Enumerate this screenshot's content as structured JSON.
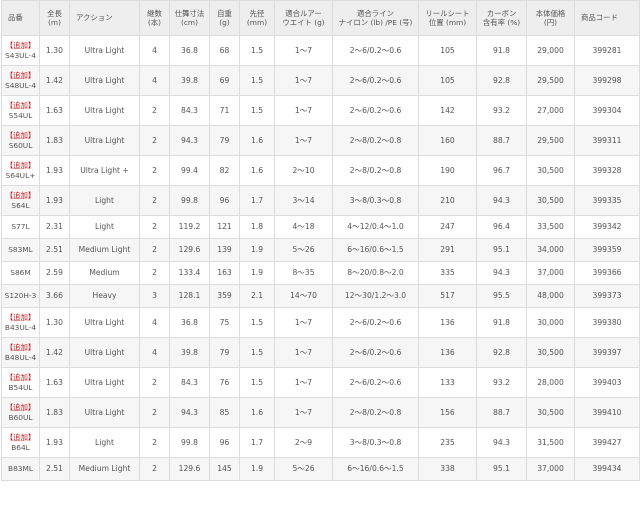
{
  "headers": [
    "品番",
    "全長\n(m)",
    "アクション",
    "継数\n(本)",
    "仕舞寸法\n(cm)",
    "自重\n(g)",
    "先径\n(mm)",
    "適合ルアー\nウエイト (g)",
    "適合ライン\nナイロン (lb) /PE (号)",
    "リールシート\n位置 (mm)",
    "カーボン\n含有率 (%)",
    "本体価格\n(円)",
    "商品コード"
  ],
  "rows": [
    {
      "tag": "【追加】",
      "cells": [
        "S43UL-4",
        "1.30",
        "Ultra Light",
        "4",
        "36.8",
        "68",
        "1.5",
        "1〜7",
        "2〜6/0.2〜0.6",
        "105",
        "91.8",
        "29,000",
        "399281"
      ]
    },
    {
      "tag": "【追加】",
      "cells": [
        "S48UL-4",
        "1.42",
        "Ultra Light",
        "4",
        "39.8",
        "69",
        "1.5",
        "1〜7",
        "2〜6/0.2〜0.6",
        "105",
        "92.8",
        "29,500",
        "399298"
      ]
    },
    {
      "tag": "【追加】",
      "cells": [
        "S54UL",
        "1.63",
        "Ultra Light",
        "2",
        "84.3",
        "71",
        "1.5",
        "1〜7",
        "2〜6/0.2〜0.6",
        "142",
        "93.2",
        "27,000",
        "399304"
      ]
    },
    {
      "tag": "【追加】",
      "cells": [
        "S60UL",
        "1.83",
        "Ultra Light",
        "2",
        "94.3",
        "79",
        "1.6",
        "1〜7",
        "2〜8/0.2〜0.8",
        "160",
        "88.7",
        "29,500",
        "399311"
      ]
    },
    {
      "tag": "【追加】",
      "cells": [
        "S64UL+",
        "1.93",
        "Ultra Light +",
        "2",
        "99.4",
        "82",
        "1.6",
        "2〜10",
        "2〜8/0.2〜0.8",
        "190",
        "96.7",
        "30,500",
        "399328"
      ]
    },
    {
      "tag": "【追加】",
      "cells": [
        "S64L",
        "1.93",
        "Light",
        "2",
        "99.8",
        "96",
        "1.7",
        "3〜14",
        "3〜8/0.3〜0.8",
        "210",
        "94.3",
        "30,500",
        "399335"
      ]
    },
    {
      "tag": "",
      "cells": [
        "S77L",
        "2.31",
        "Light",
        "2",
        "119.2",
        "121",
        "1.8",
        "4〜18",
        "4〜12/0.4〜1.0",
        "247",
        "96.4",
        "33,500",
        "399342"
      ]
    },
    {
      "tag": "",
      "cells": [
        "S83ML",
        "2.51",
        "Medium Light",
        "2",
        "129.6",
        "139",
        "1.9",
        "5〜26",
        "6〜16/0.6〜1.5",
        "291",
        "95.1",
        "34,000",
        "399359"
      ]
    },
    {
      "tag": "",
      "cells": [
        "S86M",
        "2.59",
        "Medium",
        "2",
        "133.4",
        "163",
        "1.9",
        "8〜35",
        "8〜20/0.8〜2.0",
        "335",
        "94.3",
        "37,000",
        "399366"
      ]
    },
    {
      "tag": "",
      "cells": [
        "S120H-3",
        "3.66",
        "Heavy",
        "3",
        "128.1",
        "359",
        "2.1",
        "14〜70",
        "12〜30/1.2〜3.0",
        "517",
        "95.5",
        "48,000",
        "399373"
      ]
    },
    {
      "tag": "【追加】",
      "cells": [
        "B43UL-4",
        "1.30",
        "Ultra Light",
        "4",
        "36.8",
        "75",
        "1.5",
        "1〜7",
        "2〜6/0.2〜0.6",
        "136",
        "91.8",
        "30,000",
        "399380"
      ]
    },
    {
      "tag": "【追加】",
      "cells": [
        "B48UL-4",
        "1.42",
        "Ultra Light",
        "4",
        "39.8",
        "79",
        "1.5",
        "1〜7",
        "2〜6/0.2〜0.6",
        "136",
        "92.8",
        "30,500",
        "399397"
      ]
    },
    {
      "tag": "【追加】",
      "cells": [
        "B54UL",
        "1.63",
        "Ultra Light",
        "2",
        "84.3",
        "76",
        "1.5",
        "1〜7",
        "2〜6/0.2〜0.6",
        "133",
        "93.2",
        "28,000",
        "399403"
      ]
    },
    {
      "tag": "【追加】",
      "cells": [
        "B60UL",
        "1.83",
        "Ultra Light",
        "2",
        "94.3",
        "85",
        "1.6",
        "1〜7",
        "2〜8/0.2〜0.8",
        "156",
        "88.7",
        "30,500",
        "399410"
      ]
    },
    {
      "tag": "【追加】",
      "cells": [
        "B64L",
        "1.93",
        "Light",
        "2",
        "99.8",
        "96",
        "1.7",
        "2〜9",
        "3〜8/0.3〜0.8",
        "235",
        "94.3",
        "31,500",
        "399427"
      ]
    },
    {
      "tag": "",
      "cells": [
        "B83ML",
        "2.51",
        "Medium Light",
        "2",
        "129.6",
        "145",
        "1.9",
        "5〜26",
        "6〜16/0.6〜1.5",
        "338",
        "95.1",
        "37,000",
        "399434"
      ]
    }
  ]
}
